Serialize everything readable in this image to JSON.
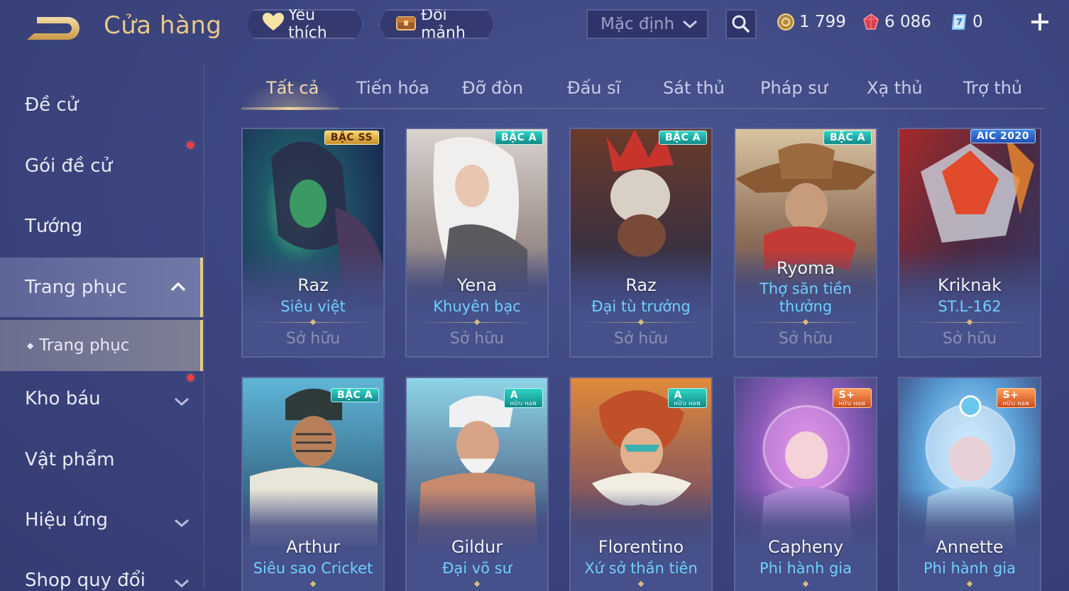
{
  "header": {
    "title": "Cửa hàng",
    "favorites_label": "Yêu thích",
    "exchange_label": "Đổi mảnh",
    "sort_value": "Mặc định",
    "currencies": [
      {
        "name": "gold-coin",
        "value": "1 799",
        "color": "#d8b96a"
      },
      {
        "name": "ruby",
        "value": "6 086",
        "color": "#e0485a"
      },
      {
        "name": "voucher",
        "value": "0",
        "color": "#7fc4ff"
      }
    ]
  },
  "sidebar": {
    "items": [
      {
        "label": "Đề cử"
      },
      {
        "label": "Gói đề cử"
      },
      {
        "label": "Tướng"
      },
      {
        "label": "Trang phục"
      },
      {
        "label": "Trang phục"
      },
      {
        "label": "Kho báu"
      },
      {
        "label": "Vật phẩm"
      },
      {
        "label": "Hiệu ứng"
      },
      {
        "label": "Shop quy đổi"
      }
    ]
  },
  "tabs": [
    "Tất cả",
    "Tiến hóa",
    "Đỡ đòn",
    "Đấu sĩ",
    "Sát thủ",
    "Pháp sư",
    "Xạ thủ",
    "Trợ thủ"
  ],
  "cards": [
    {
      "hero": "Raz",
      "skin": "Siêu việt",
      "status": "Sở hữu",
      "badge": "BẬC SS",
      "badge_sub": ""
    },
    {
      "hero": "Yena",
      "skin": "Khuyên bạc",
      "status": "Sở hữu",
      "badge": "BẬC A",
      "badge_sub": ""
    },
    {
      "hero": "Raz",
      "skin": "Đại tù trưởng",
      "status": "Sở hữu",
      "badge": "BẬC A",
      "badge_sub": ""
    },
    {
      "hero": "Ryoma",
      "skin": "Thợ săn tiền thưởng",
      "status": "Sở hữu",
      "badge": "BẬC A",
      "badge_sub": ""
    },
    {
      "hero": "Kriknak",
      "skin": "ST.L-162",
      "status": "Sở hữu",
      "badge": "AIC 2020",
      "badge_sub": ""
    },
    {
      "hero": "Arthur",
      "skin": "Siêu sao Cricket",
      "badge": "BẬC A",
      "badge_sub": ""
    },
    {
      "hero": "Gildur",
      "skin": "Đại võ sư",
      "badge": "A",
      "badge_sub": "HỮU HẠN"
    },
    {
      "hero": "Florentino",
      "skin": "Xứ sở thần tiên",
      "badge": "A",
      "badge_sub": "HỮU HẠN"
    },
    {
      "hero": "Capheny",
      "skin": "Phi hành gia",
      "badge": "S+",
      "badge_sub": "HỮU HẠN"
    },
    {
      "hero": "Annette",
      "skin": "Phi hành gia",
      "badge": "S+",
      "badge_sub": "HỮU HẠN"
    }
  ],
  "colors": {
    "accent_gold": "#e8c98a",
    "skin_blue": "#6fd0ff",
    "notification_red": "#ff3b3b"
  }
}
